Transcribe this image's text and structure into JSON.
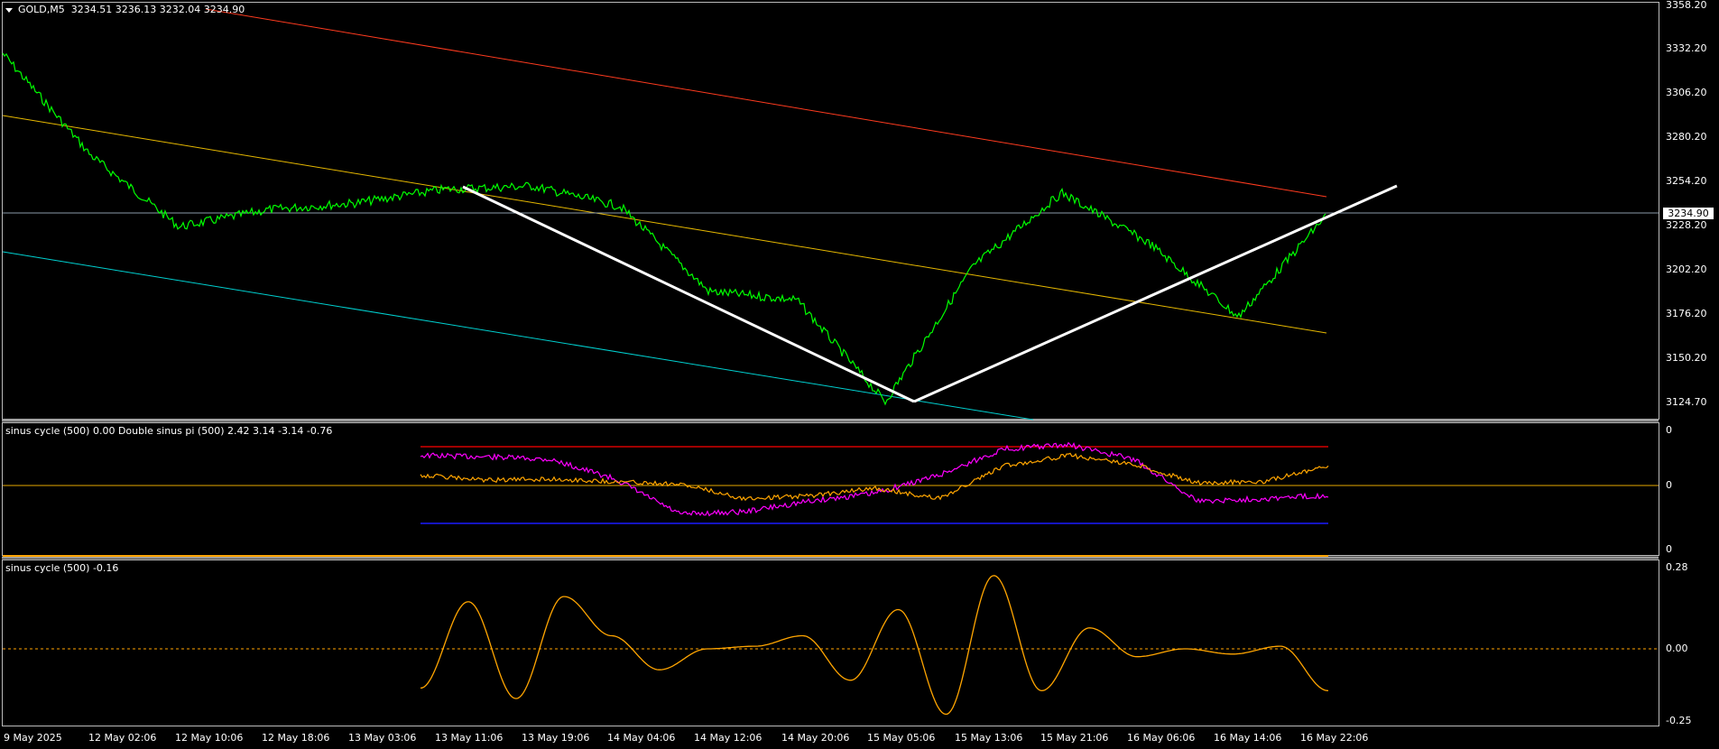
{
  "header": {
    "symbol": "GOLD,M5",
    "ohlc": "3234.51 3236.13 3232.04 3234.90"
  },
  "main_axis": {
    "labels": [
      "3358.20",
      "3332.20",
      "3306.20",
      "3280.20",
      "3254.20",
      "3228.20",
      "3202.20",
      "3176.20",
      "3150.20",
      "3124.70"
    ]
  },
  "current_price": "3234.90",
  "indicator1": {
    "title": "sinus cycle (500) 0.00  Double sinus pi (500) 2.42 3.14 -3.14 -0.76",
    "axis_labels": [
      "0",
      "0",
      "0"
    ]
  },
  "indicator2": {
    "title": "sinus cycle (500) -0.16",
    "axis_labels": [
      "0.28",
      "0.00",
      "-0.25"
    ]
  },
  "time_axis": {
    "labels": [
      "9 May 2025",
      "12 May 02:06",
      "12 May 10:06",
      "12 May 18:06",
      "13 May 03:06",
      "13 May 11:06",
      "13 May 19:06",
      "14 May 04:06",
      "14 May 12:06",
      "14 May 20:06",
      "15 May 05:06",
      "15 May 13:06",
      "15 May 21:06",
      "16 May 06:06",
      "16 May 14:06",
      "16 May 22:06"
    ]
  },
  "colors": {
    "price": "#00ff00",
    "trend_white": "#ffffff",
    "channel_red": "#ff3b1f",
    "channel_yellow": "#e6b800",
    "channel_cyan": "#00d0d0",
    "magenta": "#ff00ff",
    "orange": "#ffa500",
    "level_red": "#ff0000",
    "level_blue": "#0000ff"
  },
  "chart_data": [
    {
      "type": "line",
      "title": "GOLD,M5",
      "ylim": [
        3115,
        3360
      ],
      "x": [
        "9 May 2025",
        "12 May 02:06",
        "12 May 10:06",
        "12 May 18:06",
        "13 May 03:06",
        "13 May 11:06",
        "13 May 19:06",
        "14 May 04:06",
        "14 May 12:06",
        "14 May 20:06",
        "15 May 05:06",
        "15 May 13:06",
        "15 May 21:06",
        "16 May 06:06",
        "16 May 14:06",
        "16 May 22:06"
      ],
      "series": [
        {
          "values": [
            3330,
            3270,
            3228,
            3238,
            3242,
            3250,
            3252,
            3240,
            3190,
            3185,
            3125,
            3205,
            3248,
            3218,
            3175,
            3234.9
          ]
        }
      ]
    },
    {
      "type": "line",
      "title": "sinus cycle (500) 0.00  Double sinus pi (500) 2.42 3.14 -3.14 -0.76",
      "series": [
        {
          "values": [
            2.3,
            2.2,
            2.0,
            0.5,
            -2.2,
            -2.0,
            -1.2,
            -0.6,
            0.8,
            2.8,
            3.1,
            2.0,
            -1.2,
            -1.0,
            -0.76
          ]
        },
        {
          "values": [
            0.8,
            0.4,
            0.5,
            0.3,
            0.1,
            -1.0,
            -0.8,
            -0.2,
            -1.0,
            1.5,
            2.3,
            1.6,
            0.2,
            0.3,
            1.5
          ]
        }
      ]
    },
    {
      "type": "line",
      "title": "sinus cycle (500) -0.16",
      "ylim": [
        -0.25,
        0.28
      ],
      "series": [
        {
          "values": [
            -0.15,
            0.18,
            -0.19,
            0.2,
            0.05,
            -0.08,
            0.0,
            0.01,
            0.05,
            -0.12,
            0.15,
            -0.25,
            0.28,
            -0.16,
            0.08,
            -0.03,
            0.0,
            -0.02,
            0.01,
            -0.16
          ]
        }
      ]
    }
  ]
}
